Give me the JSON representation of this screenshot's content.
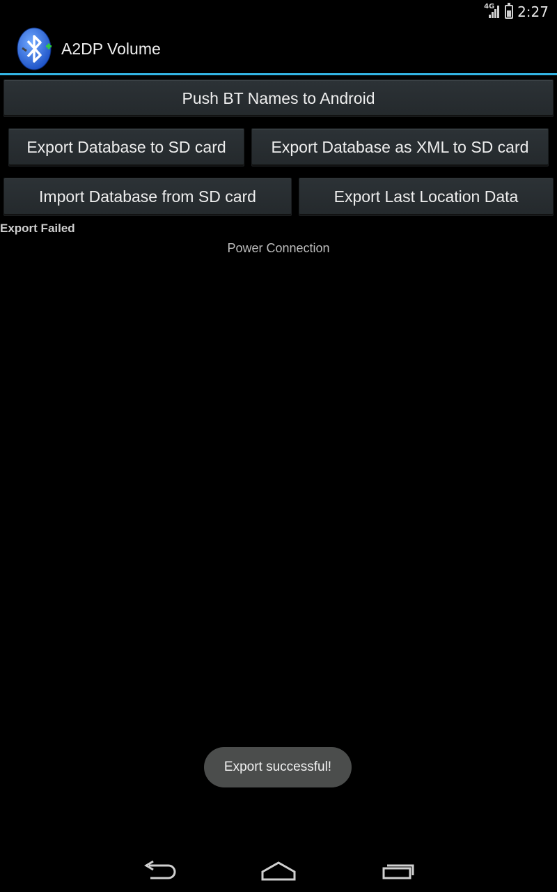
{
  "status_bar": {
    "network": "4G",
    "time": "2:27"
  },
  "action_bar": {
    "title": "A2DP Volume",
    "icon": "bluetooth-app-icon"
  },
  "buttons": {
    "push_bt_names": "Push BT Names to Android",
    "export_db_sd": "Export Database to SD card",
    "export_db_xml_sd": "Export Database as XML to SD card",
    "import_db_sd": "Import Database from SD card",
    "export_last_location": "Export Last Location Data"
  },
  "status_text": "Export Failed",
  "power_connection_label": "Power Connection",
  "toast": "Export successful!",
  "nav": {
    "back_icon": "back-icon",
    "home_icon": "home-icon",
    "recents_icon": "recents-icon"
  },
  "colors": {
    "accent": "#33b5e5",
    "background": "#000000",
    "button": "#282d30",
    "toast": "#4b4d4c"
  }
}
